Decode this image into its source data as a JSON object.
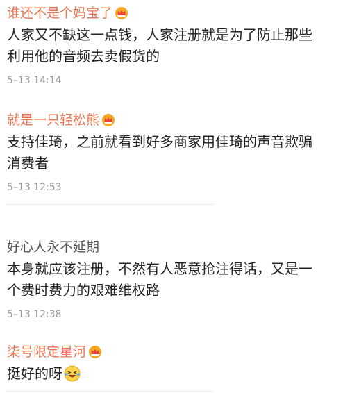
{
  "comments": [
    {
      "username": "谁还不是个妈宝了",
      "vip": true,
      "text_lines": [
        "人家又不缺这一点钱，人家注册就是为了防止那些",
        "利用他的音频去卖假货的"
      ],
      "time": "5–13 14:14"
    },
    {
      "username": "就是一只轻松熊",
      "vip": true,
      "text_lines": [
        "支持佳琦，之前就看到好多商家用佳琦的声音欺骗",
        "消费者"
      ],
      "time": "5–13 12:53"
    },
    {
      "username": "好心人永不延期",
      "vip": false,
      "text_lines": [
        "本身就应该注册，不然有人恶意抢注得话，又是一",
        "个费时费力的艰难维权路"
      ],
      "time": "5–13 12:38"
    },
    {
      "username": "柒号限定星河",
      "vip": true,
      "text_lines": [
        "挺好的呀"
      ],
      "emoji": "laughing-crying-emoji"
    }
  ],
  "icons": {
    "vip_badge": "crown-icon",
    "accent": "#eb7350",
    "crown_color": "#f5a623"
  }
}
